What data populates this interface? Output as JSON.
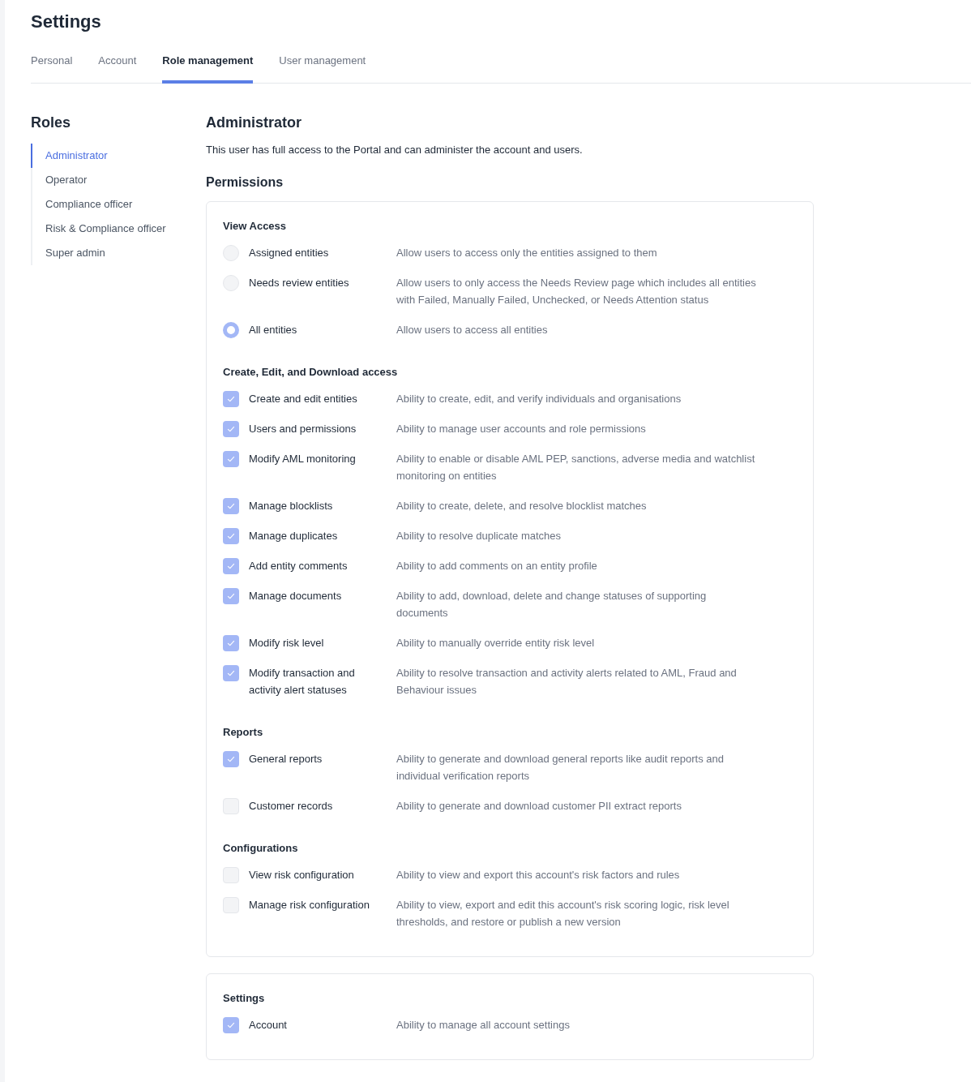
{
  "page": {
    "title": "Settings"
  },
  "tabs": [
    {
      "label": "Personal",
      "selected": false
    },
    {
      "label": "Account",
      "selected": false
    },
    {
      "label": "Role management",
      "selected": true
    },
    {
      "label": "User management",
      "selected": false
    }
  ],
  "sidebar": {
    "title": "Roles",
    "items": [
      {
        "label": "Administrator",
        "selected": true
      },
      {
        "label": "Operator",
        "selected": false
      },
      {
        "label": "Compliance officer",
        "selected": false
      },
      {
        "label": "Risk & Compliance officer",
        "selected": false
      },
      {
        "label": "Super admin",
        "selected": false
      }
    ]
  },
  "role": {
    "title": "Administrator",
    "description": "This user has full access to the Portal and can administer the account and users."
  },
  "permissions_title": "Permissions",
  "cards": [
    {
      "sections": [
        {
          "title": "View Access",
          "kind": "radio",
          "items": [
            {
              "label": "Assigned entities",
              "description": "Allow users to access only the entities assigned to them",
              "selected": false
            },
            {
              "label": "Needs review entities",
              "description": "Allow users to only access the Needs Review page which includes all entities with Failed, Manually Failed, Unchecked, or Needs Attention status",
              "selected": false
            },
            {
              "label": "All entities",
              "description": "Allow users to access all entities",
              "selected": true
            }
          ]
        },
        {
          "title": "Create, Edit, and Download access",
          "kind": "checkbox",
          "items": [
            {
              "label": "Create and edit entities",
              "description": "Ability to create, edit, and verify individuals and organisations",
              "checked": true
            },
            {
              "label": "Users and permissions",
              "description": "Ability to manage user accounts and role permissions",
              "checked": true
            },
            {
              "label": "Modify AML monitoring",
              "description": "Ability to enable or disable AML PEP, sanctions, adverse media and watchlist monitoring on entities",
              "checked": true
            },
            {
              "label": "Manage blocklists",
              "description": "Ability to create, delete, and resolve blocklist matches",
              "checked": true
            },
            {
              "label": "Manage duplicates",
              "description": "Ability to resolve duplicate matches",
              "checked": true
            },
            {
              "label": "Add entity comments",
              "description": "Ability to add comments on an entity profile",
              "checked": true
            },
            {
              "label": "Manage documents",
              "description": "Ability to add, download, delete and change statuses of supporting documents",
              "checked": true
            },
            {
              "label": "Modify risk level",
              "description": "Ability to manually override entity risk level",
              "checked": true
            },
            {
              "label": "Modify transaction and activity alert statuses",
              "description": "Ability to resolve transaction and activity alerts related to AML, Fraud and Behaviour issues",
              "checked": true
            }
          ]
        },
        {
          "title": "Reports",
          "kind": "checkbox",
          "items": [
            {
              "label": "General reports",
              "description": "Ability to generate and download general reports like audit reports and individual verification reports",
              "checked": true
            },
            {
              "label": "Customer records",
              "description": "Ability to generate and download customer PII extract reports",
              "checked": false
            }
          ]
        },
        {
          "title": "Configurations",
          "kind": "checkbox",
          "items": [
            {
              "label": "View risk configuration",
              "description": "Ability to view and export this account's risk factors and rules",
              "checked": false
            },
            {
              "label": "Manage risk configuration",
              "description": "Ability to view, export and edit this account's risk scoring logic, risk level thresholds, and restore or publish a new version",
              "checked": false
            }
          ]
        }
      ]
    },
    {
      "sections": [
        {
          "title": "Settings",
          "kind": "checkbox",
          "items": [
            {
              "label": "Account",
              "description": "Ability to manage all account settings",
              "checked": true
            }
          ]
        }
      ]
    }
  ]
}
